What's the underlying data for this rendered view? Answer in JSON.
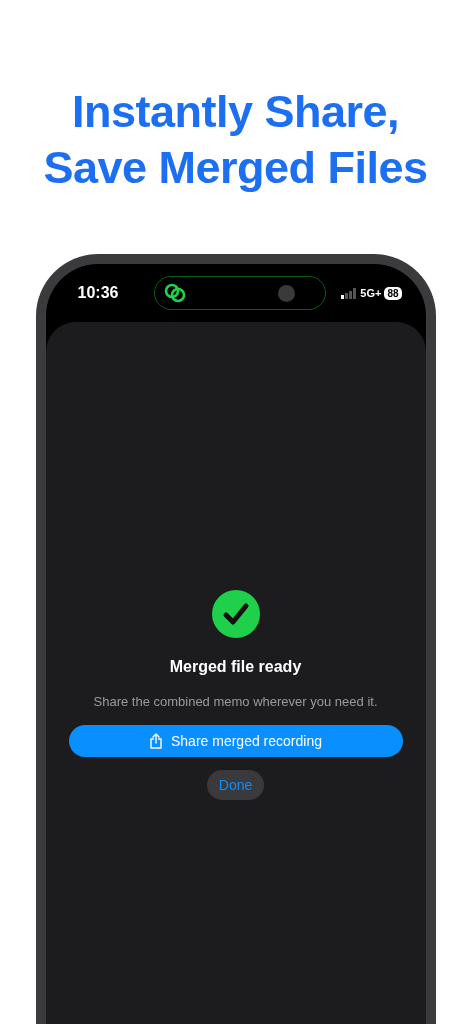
{
  "headline": [
    "Instantly Share,",
    "Save Merged Files"
  ],
  "status_bar": {
    "time": "10:36",
    "network": "5G+",
    "battery": "88"
  },
  "sheet": {
    "title": "Merged file ready",
    "message": "Share the combined memo wherever you need it.",
    "primary_button": "Share merged recording",
    "secondary_button": "Done"
  }
}
